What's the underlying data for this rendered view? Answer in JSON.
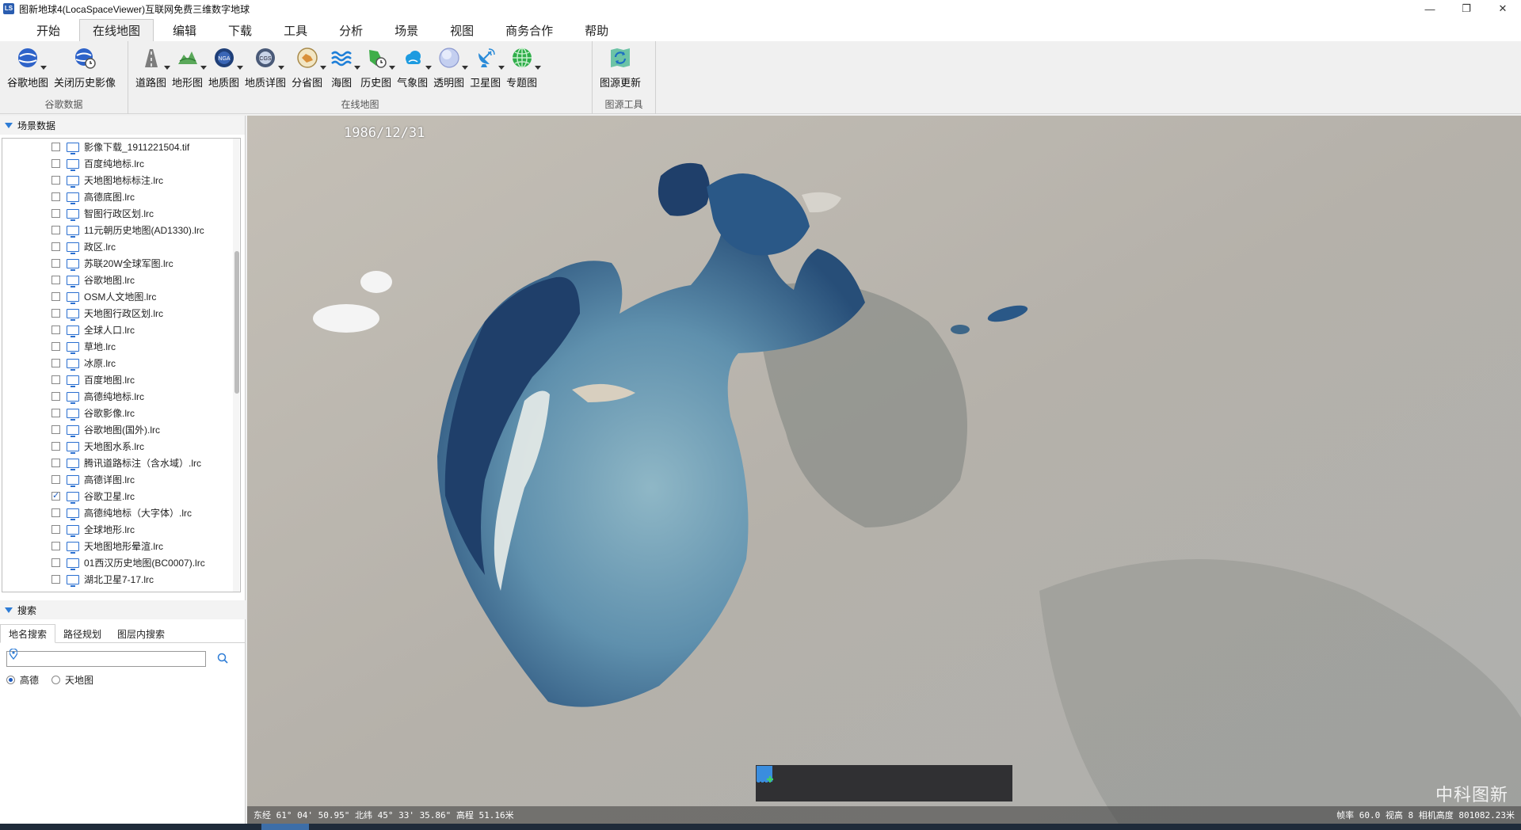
{
  "window": {
    "app_icon_text": "LS",
    "title": "图新地球4(LocaSpaceViewer)互联网免费三维数字地球",
    "minimize": "—",
    "restore": "❐",
    "close": "✕"
  },
  "menu": {
    "tabs": [
      {
        "label": "开始"
      },
      {
        "label": "在线地图"
      },
      {
        "label": "编辑"
      },
      {
        "label": "下载"
      },
      {
        "label": "工具"
      },
      {
        "label": "分析"
      },
      {
        "label": "场景"
      },
      {
        "label": "视图"
      },
      {
        "label": "商务合作"
      },
      {
        "label": "帮助"
      }
    ],
    "active": "在线地图"
  },
  "ribbon": {
    "groups": [
      {
        "label": "谷歌数据",
        "tools": [
          {
            "label": "谷歌地图"
          },
          {
            "label": "关闭历史影像"
          }
        ]
      },
      {
        "label": "在线地图",
        "tools": [
          {
            "label": "道路图"
          },
          {
            "label": "地形图"
          },
          {
            "label": "地质图"
          },
          {
            "label": "地质详图"
          },
          {
            "label": "分省图"
          },
          {
            "label": "海图"
          },
          {
            "label": "历史图"
          },
          {
            "label": "气象图"
          },
          {
            "label": "透明图"
          },
          {
            "label": "卫星图"
          },
          {
            "label": "专题图"
          }
        ]
      },
      {
        "label": "图源工具",
        "tools": [
          {
            "label": "图源更新"
          }
        ]
      }
    ],
    "icon_texts": {
      "nga": "NGA",
      "cgs": "CGS"
    }
  },
  "scene_panel": {
    "title": "场景数据",
    "layers": [
      {
        "name": "影像下载_1911221504.tif",
        "checked": false
      },
      {
        "name": "百度纯地标.lrc",
        "checked": false
      },
      {
        "name": "天地图地标标注.lrc",
        "checked": false
      },
      {
        "name": "高德底图.lrc",
        "checked": false
      },
      {
        "name": "智图行政区划.lrc",
        "checked": false
      },
      {
        "name": "11元朝历史地图(AD1330).lrc",
        "checked": false
      },
      {
        "name": "政区.lrc",
        "checked": false
      },
      {
        "name": "苏联20W全球军图.lrc",
        "checked": false
      },
      {
        "name": "谷歌地图.lrc",
        "checked": false
      },
      {
        "name": "OSM人文地图.lrc",
        "checked": false
      },
      {
        "name": "天地图行政区划.lrc",
        "checked": false
      },
      {
        "name": "全球人口.lrc",
        "checked": false
      },
      {
        "name": "草地.lrc",
        "checked": false
      },
      {
        "name": "冰原.lrc",
        "checked": false
      },
      {
        "name": "百度地图.lrc",
        "checked": false
      },
      {
        "name": "高德纯地标.lrc",
        "checked": false
      },
      {
        "name": "谷歌影像.lrc",
        "checked": false
      },
      {
        "name": "谷歌地图(国外).lrc",
        "checked": false
      },
      {
        "name": "天地图水系.lrc",
        "checked": false
      },
      {
        "name": "腾讯道路标注（含水域）.lrc",
        "checked": false
      },
      {
        "name": "高德详图.lrc",
        "checked": false
      },
      {
        "name": "谷歌卫星.lrc",
        "checked": true
      },
      {
        "name": "高德纯地标（大字体）.lrc",
        "checked": false
      },
      {
        "name": "全球地形.lrc",
        "checked": false
      },
      {
        "name": "天地图地形晕渲.lrc",
        "checked": false
      },
      {
        "name": "01西汉历史地图(BC0007).lrc",
        "checked": false
      },
      {
        "name": "湖北卫星7-17.lrc",
        "checked": false
      }
    ]
  },
  "search_panel": {
    "title": "搜索",
    "tabs": [
      {
        "label": "地名搜索"
      },
      {
        "label": "路径规划"
      },
      {
        "label": "图层内搜索"
      }
    ],
    "input_value": "",
    "providers": [
      {
        "label": "高德",
        "selected": true
      },
      {
        "label": "天地图",
        "selected": false
      }
    ]
  },
  "map": {
    "date": "1986/12/31",
    "watermark": "中科图新",
    "coords": "东经 61° 04' 50.95\" 北纬 45° 33' 35.86\"  高程 51.16米",
    "status_right": "帧率 60.0 视高 8 相机高度 801082.23米"
  },
  "colors": {
    "accent": "#2d7cd6",
    "water_deep": "#1f3f6a",
    "water_shallow": "#6f9bb4",
    "land": "#b9b5ae"
  }
}
